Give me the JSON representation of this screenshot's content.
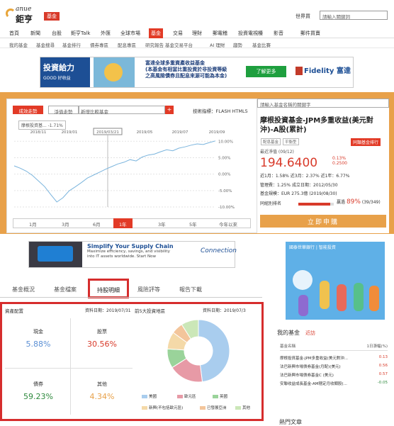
{
  "header": {
    "logo_en": "anue",
    "logo_cn": "鉅亨",
    "section_tag": "基金",
    "top_link": "世界買",
    "search_placeholder": "請輸入關鍵詞"
  },
  "nav_main": [
    "首頁",
    "新聞",
    "台股",
    "鉅亨Talk",
    "外匯",
    "全球市場",
    "基金",
    "交易",
    "理財",
    "郵電稽",
    "投資電視檯",
    "影音",
    "郵件買賣"
  ],
  "nav_sub": [
    "我的基金",
    "基金搜尋",
    "基金排行",
    "債券專區",
    "配息專區",
    "研究報告",
    "基金交易平台",
    "AI 理財",
    "趨勢",
    "基金比賽"
  ],
  "banner": {
    "title": "投資給力",
    "subtitle": "GOOD 好收益",
    "headline": "富達全球多重資產收益基金",
    "line1": "(本基金有相當比重投資於非投資等級",
    "line2": "之高風險債券且配息來源可能為本金)",
    "button": "了解更多",
    "brand": "Fidelity 富達"
  },
  "chart_panel": {
    "tab_active": "成效走勢",
    "tab_other": "淨值走勢",
    "compare_placeholder": "新增比較基金",
    "tech_label": "技術指標：FLASH HTML5",
    "series_legend": "摩根投資基... -1.71%",
    "periods": [
      "1月",
      "3月",
      "6月",
      "1年",
      "3年",
      "5年",
      "今年以來"
    ],
    "active_period": "1年"
  },
  "chart_data": {
    "type": "line",
    "x_labels": [
      "2018/11",
      "2019/01",
      "2019/03/21",
      "2019/05",
      "2019/07",
      "2019/09"
    ],
    "y_ticks": [
      "10.00%",
      "5.00%",
      "0.00%",
      "-5.00%",
      "-10.00%"
    ],
    "ylim": [
      -10,
      12
    ],
    "values": [
      2.5,
      1.8,
      0.9,
      -0.4,
      -2.1,
      -3.8,
      -6.2,
      -8.5,
      -7.2,
      -5.1,
      -3.9,
      -2.6,
      -1.2,
      -0.3,
      0.6,
      1.5,
      2.3,
      3.1,
      3.6,
      4.4,
      4.0,
      5.2,
      5.8,
      6.1,
      6.8,
      7.4,
      7.1,
      7.9,
      8.3,
      8.8,
      9.2,
      9.0,
      9.6,
      10.1
    ]
  },
  "fund_info": {
    "search_placeholder": "請輸入基金名稱的關鍵字",
    "name": "摩根投資基金-JPM多重收益(美元對沖)-A股(累計)",
    "tag1": "配息基金",
    "tag2": "平衡型",
    "buy_btn": "同類基金排行",
    "nav_label": "最近淨值 (09/12)",
    "nav_value": "194.6400",
    "change_pct": "0.13%",
    "change_abs": "0.2500",
    "perf": "近1月：1.58%  近3月：2.37%  近1年：6.77%",
    "fee": "管理費：1.25%  成立日期：2012/05/30",
    "size": "基金規模：EUR 275.3億 (2019/08/30)",
    "rank_label": "同組別排名",
    "rank_pct": "89%",
    "rank_word": "贏過",
    "rank_count": "(39/349)",
    "apply": "立即申購"
  },
  "ad2": {
    "title": "Simplify Your Supply Chain",
    "text1": "Maximize efficiency, savings, and visibility",
    "text2": "into IT assets worldwide.  Start Now",
    "brand": "Connection"
  },
  "ad3": {
    "header": "國泰世華銀行 | 智能投資"
  },
  "tabs": [
    "基金概況",
    "基金檔案",
    "持股明細",
    "風險評等",
    "報告下載"
  ],
  "asset_alloc": {
    "title": "資產配置",
    "date": "資料日期：2019/07/31",
    "cells": [
      {
        "label": "現金",
        "value": "5.88%",
        "color": "#5b8fd4"
      },
      {
        "label": "股票",
        "value": "30.56%",
        "color": "#d83a2a"
      },
      {
        "label": "債券",
        "value": "59.23%",
        "color": "#2f8a3e"
      },
      {
        "label": "其他",
        "value": "4.34%",
        "color": "#e8a14a"
      }
    ]
  },
  "regions": {
    "title": "前5大投資地區",
    "date": "資料日期：2019/07/3",
    "slices": [
      {
        "label": "美國",
        "value": 48,
        "color": "#a9cdee"
      },
      {
        "label": "歐元區",
        "value": 18,
        "color": "#e79aa6"
      },
      {
        "label": "英國",
        "value": 10,
        "color": "#9ad39a"
      },
      {
        "label": "新興(不包括歐元區)",
        "value": 9,
        "color": "#f4d9a8"
      },
      {
        "label": "已發展亞洲",
        "value": 6,
        "color": "#f3c59b"
      },
      {
        "label": "其他",
        "value": 9,
        "color": "#cbe7b8"
      }
    ]
  },
  "my_funds": {
    "title": "我的基金",
    "recent": "近訪",
    "col1": "基金名稱",
    "col2": "1日漲幅(%)",
    "rows": [
      {
        "name": "摩根投資基金-JPM多重收益(美元對沖...",
        "val": "0.13"
      },
      {
        "name": "法巴新興市場債券基金(月配)(美元)",
        "val": "0.56"
      },
      {
        "name": "法巴新興市場債券基金C (美元)",
        "val": "0.57"
      },
      {
        "name": "安聯收益成長基金-AM穩定月收類股(...",
        "val": "-0.05"
      }
    ]
  },
  "bottom_text": "熱門文章"
}
